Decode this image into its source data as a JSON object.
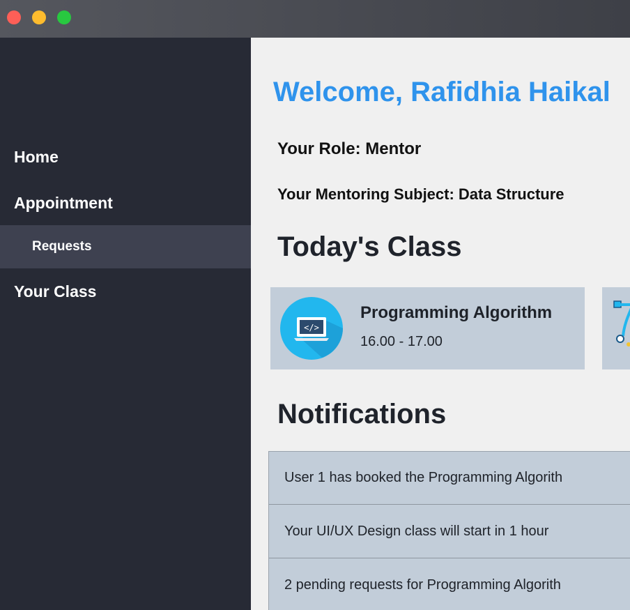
{
  "window": {
    "controls": [
      "close",
      "minimize",
      "maximize"
    ],
    "colors": {
      "close": "#fe5f57",
      "minimize": "#febc2e",
      "maximize": "#28c840"
    }
  },
  "sidebar": {
    "items": [
      {
        "label": "Home",
        "active": false
      },
      {
        "label": "Appointment",
        "active": false
      },
      {
        "label": "Requests",
        "active": true,
        "sub": true
      },
      {
        "label": "Your Class",
        "active": false
      }
    ]
  },
  "main": {
    "welcome": "Welcome, Rafidhia Haikal",
    "role": "Your Role: Mentor",
    "subject": "Your Mentoring Subject: Data Structure",
    "today_heading": "Today's Class",
    "classes": [
      {
        "title": "Programming Algorithm",
        "time": "16.00 - 17.00",
        "icon": "laptop-code-icon"
      },
      {
        "title": "",
        "time": "",
        "icon": "design-pen-icon"
      }
    ],
    "notifications_heading": "Notifications",
    "notifications": [
      "User 1 has booked the Programming Algorith",
      "Your UI/UX Design class will start in 1 hour",
      "2 pending requests for Programming Algorith"
    ]
  },
  "colors": {
    "accent": "#2f93ec",
    "sidebar_bg": "#272a35",
    "sidebar_active": "#3e4150",
    "card_bg": "#c2cdd9"
  }
}
